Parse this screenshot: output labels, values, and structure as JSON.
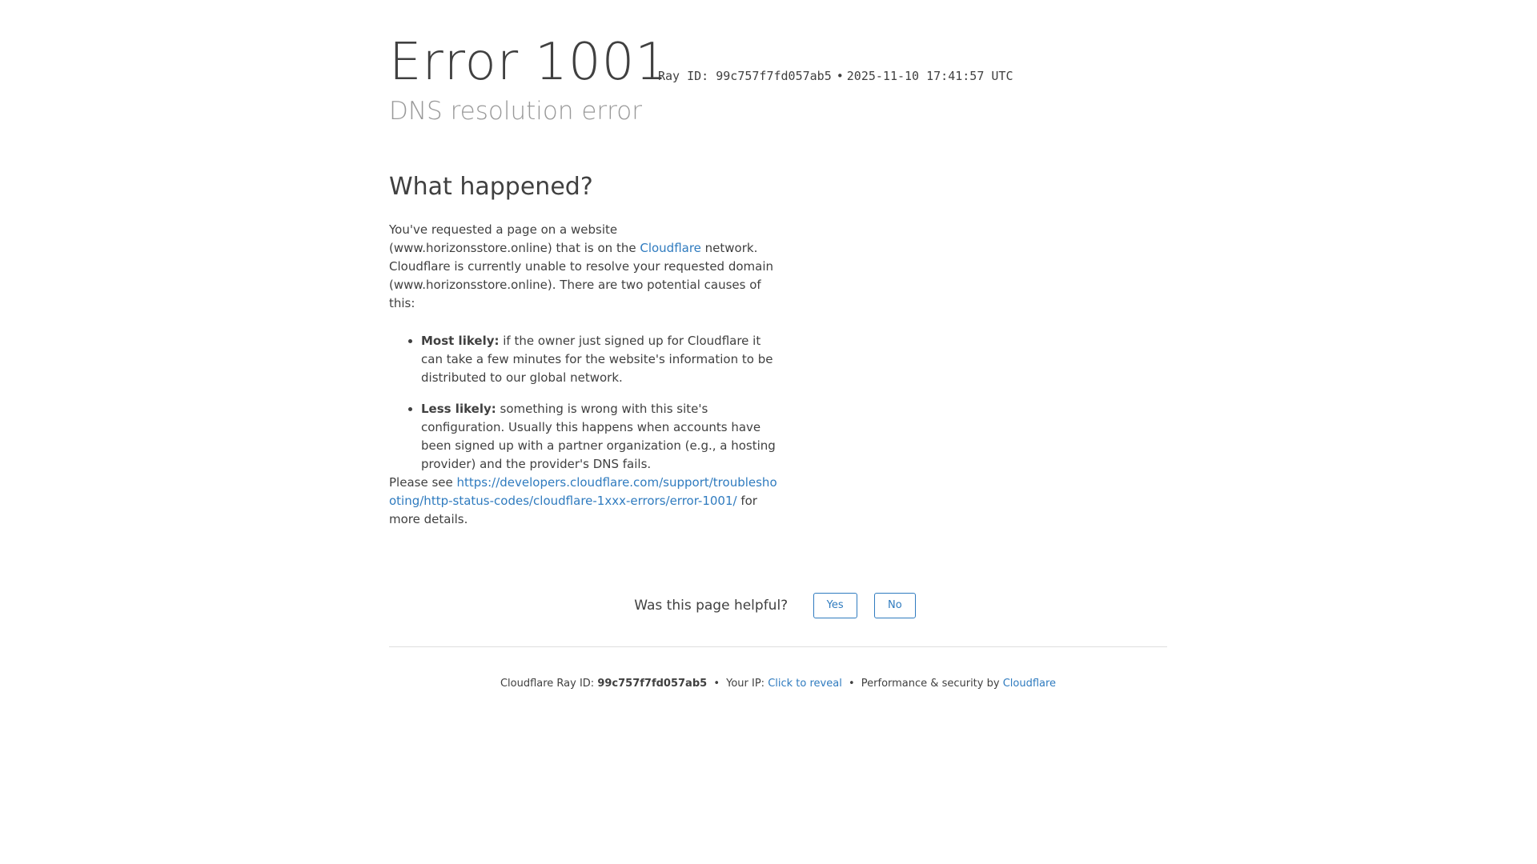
{
  "header": {
    "error_word": "Error",
    "error_code": "1001",
    "ray_id_label": "Ray ID: 99c757f7fd057ab5",
    "separator": "•",
    "timestamp": "2025-11-10 17:41:57 UTC",
    "subtitle": "DNS resolution error"
  },
  "main": {
    "heading": "What happened?",
    "intro_part1": "You've requested a page on a website (www.horizonsstore.online) that is on the ",
    "intro_link": "Cloudflare",
    "intro_part2": " network. Cloudflare is currently unable to resolve your requested domain (www.horizonsstore.online). There are two potential causes of this:",
    "causes": [
      {
        "label": "Most likely:",
        "text": " if the owner just signed up for Cloudflare it can take a few minutes for the website's information to be distributed to our global network."
      },
      {
        "label": "Less likely:",
        "text": " something is wrong with this site's configuration. Usually this happens when accounts have been signed up with a partner organization (e.g., a hosting provider) and the provider's DNS fails."
      }
    ],
    "please_see_prefix": "Please see ",
    "please_see_link": "https://developers.cloudflare.com/support/troubleshooting/http-status-codes/cloudflare-1xxx-errors/error-1001/",
    "please_see_suffix": " for more details."
  },
  "feedback": {
    "question": "Was this page helpful?",
    "yes_label": "Yes",
    "no_label": "No"
  },
  "footer": {
    "ray_label": "Cloudflare Ray ID: ",
    "ray_value": "99c757f7fd057ab5",
    "separator": "•",
    "ip_label": "Your IP: ",
    "ip_link": "Click to reveal",
    "perf_label": "Performance & security by ",
    "perf_link": "Cloudflare"
  },
  "colors": {
    "text": "#404040",
    "muted": "#999999",
    "link": "#2f7bbf",
    "divider": "#dedede",
    "background": "#ffffff"
  }
}
